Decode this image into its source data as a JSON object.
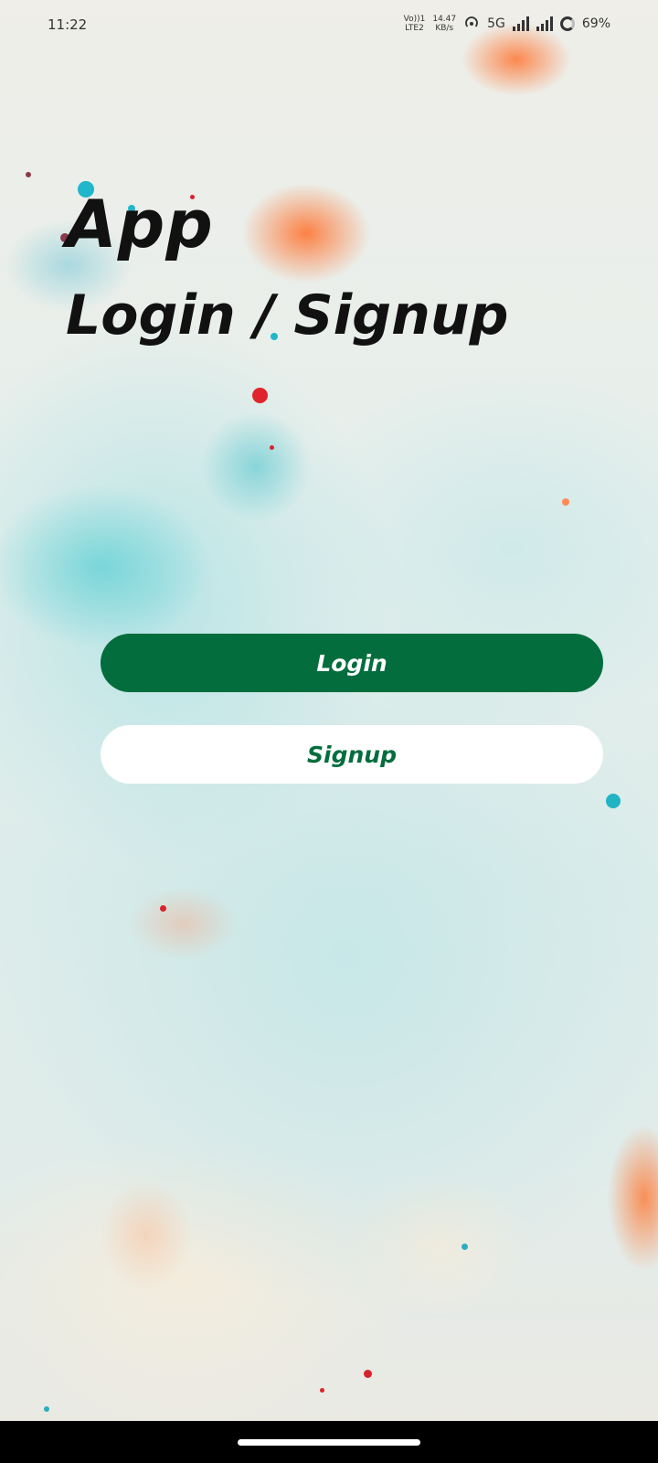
{
  "status_bar": {
    "time": "11:22",
    "volte_top": "Vo))1",
    "volte_bottom": "LTE2",
    "speed_top": "14.47",
    "speed_bottom": "KB/s",
    "network": "5G",
    "battery": "69%",
    "icons": [
      "hotspot-icon",
      "signal-icon",
      "signal-icon",
      "battery-ring-icon"
    ]
  },
  "header": {
    "title_line1": "App",
    "title_line2": "Login / Signup"
  },
  "actions": {
    "login_label": "Login",
    "signup_label": "Signup"
  },
  "colors": {
    "primary": "#036d3d",
    "on_primary": "#ffffff",
    "secondary_bg": "#ffffff"
  }
}
